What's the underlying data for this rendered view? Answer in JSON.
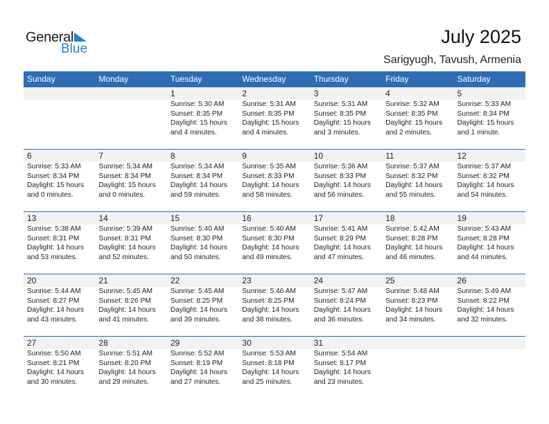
{
  "logo": {
    "general": "General",
    "blue": "Blue"
  },
  "header": {
    "title": "July 2025",
    "location": "Sarigyugh, Tavush, Armenia"
  },
  "weekdays": [
    "Sunday",
    "Monday",
    "Tuesday",
    "Wednesday",
    "Thursday",
    "Friday",
    "Saturday"
  ],
  "weeks": [
    [
      {
        "day": "",
        "sunrise": "",
        "sunset": "",
        "daylight": "",
        "daylight2": ""
      },
      {
        "day": "",
        "sunrise": "",
        "sunset": "",
        "daylight": "",
        "daylight2": ""
      },
      {
        "day": "1",
        "sunrise": "Sunrise: 5:30 AM",
        "sunset": "Sunset: 8:35 PM",
        "daylight": "Daylight: 15 hours",
        "daylight2": "and 4 minutes."
      },
      {
        "day": "2",
        "sunrise": "Sunrise: 5:31 AM",
        "sunset": "Sunset: 8:35 PM",
        "daylight": "Daylight: 15 hours",
        "daylight2": "and 4 minutes."
      },
      {
        "day": "3",
        "sunrise": "Sunrise: 5:31 AM",
        "sunset": "Sunset: 8:35 PM",
        "daylight": "Daylight: 15 hours",
        "daylight2": "and 3 minutes."
      },
      {
        "day": "4",
        "sunrise": "Sunrise: 5:32 AM",
        "sunset": "Sunset: 8:35 PM",
        "daylight": "Daylight: 15 hours",
        "daylight2": "and 2 minutes."
      },
      {
        "day": "5",
        "sunrise": "Sunrise: 5:33 AM",
        "sunset": "Sunset: 8:34 PM",
        "daylight": "Daylight: 15 hours",
        "daylight2": "and 1 minute."
      }
    ],
    [
      {
        "day": "6",
        "sunrise": "Sunrise: 5:33 AM",
        "sunset": "Sunset: 8:34 PM",
        "daylight": "Daylight: 15 hours",
        "daylight2": "and 0 minutes."
      },
      {
        "day": "7",
        "sunrise": "Sunrise: 5:34 AM",
        "sunset": "Sunset: 8:34 PM",
        "daylight": "Daylight: 15 hours",
        "daylight2": "and 0 minutes."
      },
      {
        "day": "8",
        "sunrise": "Sunrise: 5:34 AM",
        "sunset": "Sunset: 8:34 PM",
        "daylight": "Daylight: 14 hours",
        "daylight2": "and 59 minutes."
      },
      {
        "day": "9",
        "sunrise": "Sunrise: 5:35 AM",
        "sunset": "Sunset: 8:33 PM",
        "daylight": "Daylight: 14 hours",
        "daylight2": "and 58 minutes."
      },
      {
        "day": "10",
        "sunrise": "Sunrise: 5:36 AM",
        "sunset": "Sunset: 8:33 PM",
        "daylight": "Daylight: 14 hours",
        "daylight2": "and 56 minutes."
      },
      {
        "day": "11",
        "sunrise": "Sunrise: 5:37 AM",
        "sunset": "Sunset: 8:32 PM",
        "daylight": "Daylight: 14 hours",
        "daylight2": "and 55 minutes."
      },
      {
        "day": "12",
        "sunrise": "Sunrise: 5:37 AM",
        "sunset": "Sunset: 8:32 PM",
        "daylight": "Daylight: 14 hours",
        "daylight2": "and 54 minutes."
      }
    ],
    [
      {
        "day": "13",
        "sunrise": "Sunrise: 5:38 AM",
        "sunset": "Sunset: 8:31 PM",
        "daylight": "Daylight: 14 hours",
        "daylight2": "and 53 minutes."
      },
      {
        "day": "14",
        "sunrise": "Sunrise: 5:39 AM",
        "sunset": "Sunset: 8:31 PM",
        "daylight": "Daylight: 14 hours",
        "daylight2": "and 52 minutes."
      },
      {
        "day": "15",
        "sunrise": "Sunrise: 5:40 AM",
        "sunset": "Sunset: 8:30 PM",
        "daylight": "Daylight: 14 hours",
        "daylight2": "and 50 minutes."
      },
      {
        "day": "16",
        "sunrise": "Sunrise: 5:40 AM",
        "sunset": "Sunset: 8:30 PM",
        "daylight": "Daylight: 14 hours",
        "daylight2": "and 49 minutes."
      },
      {
        "day": "17",
        "sunrise": "Sunrise: 5:41 AM",
        "sunset": "Sunset: 8:29 PM",
        "daylight": "Daylight: 14 hours",
        "daylight2": "and 47 minutes."
      },
      {
        "day": "18",
        "sunrise": "Sunrise: 5:42 AM",
        "sunset": "Sunset: 8:28 PM",
        "daylight": "Daylight: 14 hours",
        "daylight2": "and 46 minutes."
      },
      {
        "day": "19",
        "sunrise": "Sunrise: 5:43 AM",
        "sunset": "Sunset: 8:28 PM",
        "daylight": "Daylight: 14 hours",
        "daylight2": "and 44 minutes."
      }
    ],
    [
      {
        "day": "20",
        "sunrise": "Sunrise: 5:44 AM",
        "sunset": "Sunset: 8:27 PM",
        "daylight": "Daylight: 14 hours",
        "daylight2": "and 43 minutes."
      },
      {
        "day": "21",
        "sunrise": "Sunrise: 5:45 AM",
        "sunset": "Sunset: 8:26 PM",
        "daylight": "Daylight: 14 hours",
        "daylight2": "and 41 minutes."
      },
      {
        "day": "22",
        "sunrise": "Sunrise: 5:45 AM",
        "sunset": "Sunset: 8:25 PM",
        "daylight": "Daylight: 14 hours",
        "daylight2": "and 39 minutes."
      },
      {
        "day": "23",
        "sunrise": "Sunrise: 5:46 AM",
        "sunset": "Sunset: 8:25 PM",
        "daylight": "Daylight: 14 hours",
        "daylight2": "and 38 minutes."
      },
      {
        "day": "24",
        "sunrise": "Sunrise: 5:47 AM",
        "sunset": "Sunset: 8:24 PM",
        "daylight": "Daylight: 14 hours",
        "daylight2": "and 36 minutes."
      },
      {
        "day": "25",
        "sunrise": "Sunrise: 5:48 AM",
        "sunset": "Sunset: 8:23 PM",
        "daylight": "Daylight: 14 hours",
        "daylight2": "and 34 minutes."
      },
      {
        "day": "26",
        "sunrise": "Sunrise: 5:49 AM",
        "sunset": "Sunset: 8:22 PM",
        "daylight": "Daylight: 14 hours",
        "daylight2": "and 32 minutes."
      }
    ],
    [
      {
        "day": "27",
        "sunrise": "Sunrise: 5:50 AM",
        "sunset": "Sunset: 8:21 PM",
        "daylight": "Daylight: 14 hours",
        "daylight2": "and 30 minutes."
      },
      {
        "day": "28",
        "sunrise": "Sunrise: 5:51 AM",
        "sunset": "Sunset: 8:20 PM",
        "daylight": "Daylight: 14 hours",
        "daylight2": "and 29 minutes."
      },
      {
        "day": "29",
        "sunrise": "Sunrise: 5:52 AM",
        "sunset": "Sunset: 8:19 PM",
        "daylight": "Daylight: 14 hours",
        "daylight2": "and 27 minutes."
      },
      {
        "day": "30",
        "sunrise": "Sunrise: 5:53 AM",
        "sunset": "Sunset: 8:18 PM",
        "daylight": "Daylight: 14 hours",
        "daylight2": "and 25 minutes."
      },
      {
        "day": "31",
        "sunrise": "Sunrise: 5:54 AM",
        "sunset": "Sunset: 8:17 PM",
        "daylight": "Daylight: 14 hours",
        "daylight2": "and 23 minutes."
      },
      {
        "day": "",
        "sunrise": "",
        "sunset": "",
        "daylight": "",
        "daylight2": ""
      },
      {
        "day": "",
        "sunrise": "",
        "sunset": "",
        "daylight": "",
        "daylight2": ""
      }
    ]
  ],
  "colors": {
    "accent": "#2e6db4",
    "logo_blue": "#2a7fc9",
    "day_row_bg": "#f2f2f2"
  }
}
